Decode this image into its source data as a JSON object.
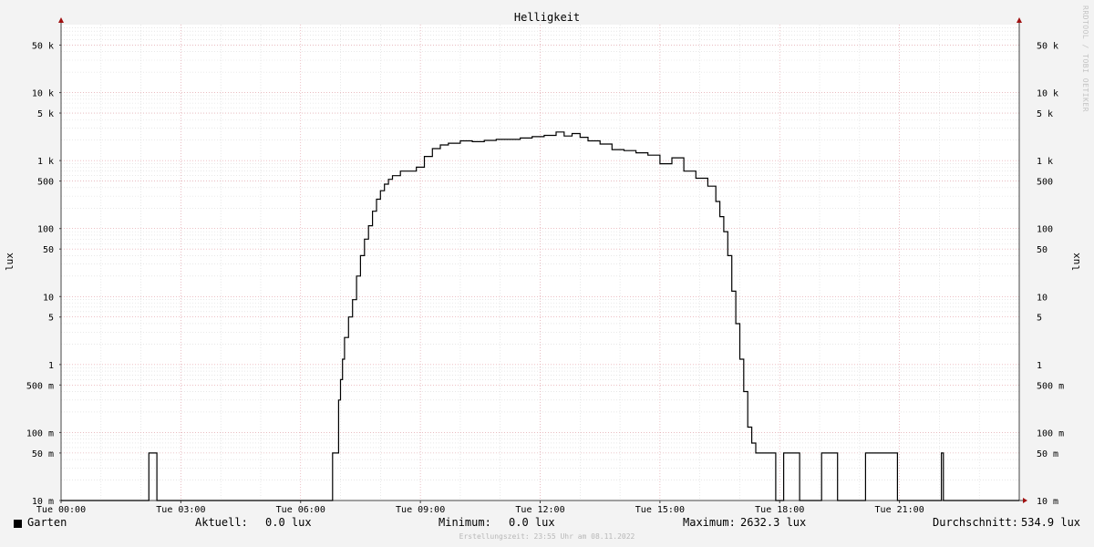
{
  "chart_data": {
    "type": "line",
    "title": "Helligkeit",
    "ylabel": "lux",
    "y_scale": "log",
    "ylim": [
      0.01,
      100000
    ],
    "x_range_hours": [
      0,
      24
    ],
    "x_tick_labels": [
      "Tue 00:00",
      "Tue 03:00",
      "Tue 06:00",
      "Tue 09:00",
      "Tue 12:00",
      "Tue 15:00",
      "Tue 18:00",
      "Tue 21:00"
    ],
    "y_ticks": [
      {
        "value": 0.01,
        "label": "10 m"
      },
      {
        "value": 0.05,
        "label": "50 m"
      },
      {
        "value": 0.1,
        "label": "100 m"
      },
      {
        "value": 0.5,
        "label": "500 m"
      },
      {
        "value": 1,
        "label": "1"
      },
      {
        "value": 5,
        "label": "5"
      },
      {
        "value": 10,
        "label": "10"
      },
      {
        "value": 50,
        "label": "50"
      },
      {
        "value": 100,
        "label": "100"
      },
      {
        "value": 500,
        "label": "500"
      },
      {
        "value": 1000,
        "label": "1 k"
      },
      {
        "value": 5000,
        "label": "5 k"
      },
      {
        "value": 10000,
        "label": "10 k"
      },
      {
        "value": 50000,
        "label": "50 k"
      }
    ],
    "grid": true,
    "series": [
      {
        "name": "Garten",
        "color": "#000000",
        "x_hours": [
          0,
          2.1,
          2.2,
          2.35,
          2.4,
          6.75,
          6.8,
          6.9,
          6.95,
          7.0,
          7.05,
          7.1,
          7.2,
          7.3,
          7.4,
          7.5,
          7.6,
          7.7,
          7.8,
          7.9,
          8.0,
          8.1,
          8.2,
          8.3,
          8.5,
          8.7,
          8.9,
          9.1,
          9.3,
          9.5,
          9.7,
          10.0,
          10.3,
          10.6,
          10.9,
          11.2,
          11.5,
          11.8,
          12.1,
          12.4,
          12.6,
          12.8,
          13.0,
          13.2,
          13.5,
          13.8,
          14.1,
          14.4,
          14.7,
          15.0,
          15.3,
          15.6,
          15.9,
          16.2,
          16.4,
          16.5,
          16.6,
          16.7,
          16.8,
          16.9,
          17.0,
          17.1,
          17.2,
          17.3,
          17.4,
          17.5,
          17.6,
          17.7,
          17.8,
          17.9,
          18.0,
          18.05,
          18.1,
          18.2,
          18.45,
          18.5,
          19.0,
          19.05,
          19.45,
          19.5,
          20.1,
          20.15,
          20.95,
          21.0,
          21.05,
          21.1,
          22.0,
          22.05,
          22.1,
          22.15,
          24.0
        ],
        "values": [
          0.01,
          0.01,
          0.05,
          0.05,
          0.01,
          0.01,
          0.05,
          0.05,
          0.3,
          0.6,
          1.2,
          2.5,
          5,
          9,
          20,
          40,
          70,
          110,
          180,
          270,
          360,
          450,
          530,
          600,
          700,
          700,
          800,
          1150,
          1500,
          1700,
          1800,
          1950,
          1900,
          1980,
          2050,
          2050,
          2150,
          2250,
          2350,
          2632.3,
          2300,
          2500,
          2200,
          1950,
          1750,
          1450,
          1400,
          1300,
          1200,
          900,
          1100,
          700,
          550,
          420,
          250,
          150,
          90,
          40,
          12,
          4,
          1.2,
          0.4,
          0.12,
          0.07,
          0.05,
          0.05,
          0.05,
          0.05,
          0.05,
          0.01,
          0.01,
          0.01,
          0.05,
          0.05,
          0.05,
          0.01,
          0.01,
          0.05,
          0.01,
          0.01,
          0.01,
          0.05,
          0.01,
          0.01,
          0.01,
          0.01,
          0.01,
          0.05,
          0.01,
          0.01,
          0.01
        ]
      }
    ]
  },
  "legend": {
    "series_name": "Garten",
    "current_label": "Aktuell:",
    "current_value": "0.0 lux",
    "minimum_label": "Minimum:",
    "minimum_value": "0.0 lux",
    "maximum_label": "Maximum:",
    "maximum_value": "2632.3 lux",
    "average_label": "Durchschnitt:",
    "average_value": "534.9 lux"
  },
  "footer_text": "Erstellungszeit: 23:55 Uhr am 08.11.2022",
  "watermark": "RRDTOOL / TOBI OETIKER"
}
